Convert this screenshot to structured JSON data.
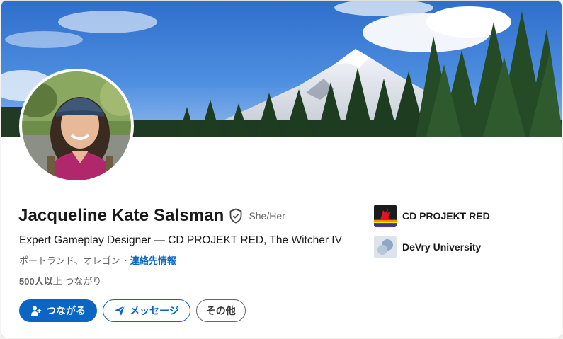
{
  "profile": {
    "name": "Jacqueline Kate Salsman",
    "pronouns": "She/Her",
    "headline": "Expert Gameplay Designer — CD PROJEKT RED, The Witcher IV",
    "location": "ポートランド、オレゴン",
    "separator": "·",
    "contact_info_label": "連絡先情報",
    "connections_count": "500人以上",
    "connections_label": "つながり"
  },
  "actions": {
    "connect_label": "つながる",
    "message_label": "メッセージ",
    "more_label": "その他"
  },
  "organizations": [
    {
      "name": "CD PROJEKT RED",
      "logo_icon": "cd-projekt-red-logo"
    },
    {
      "name": "DeVry University",
      "logo_icon": "devry-university-logo"
    }
  ],
  "colors": {
    "accent": "#0a66c2",
    "text_primary": "#191919",
    "text_secondary": "#666666",
    "card_background": "#ffffff"
  },
  "icons": {
    "verified": "shield-check-icon",
    "connect": "person-add-icon",
    "message": "send-icon"
  }
}
